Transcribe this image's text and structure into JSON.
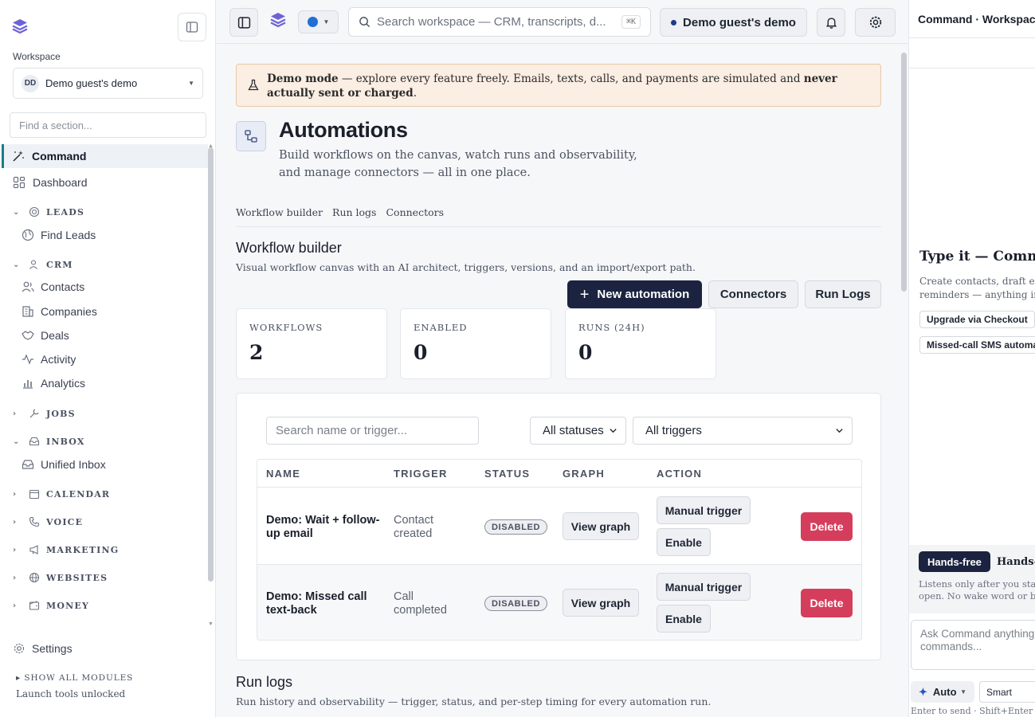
{
  "sidebar": {
    "workspace_label": "Workspace",
    "workspace": {
      "initials": "DD",
      "name": "Demo guest's demo"
    },
    "find_placeholder": "Find a section...",
    "active_item": "Command",
    "dashboard": "Dashboard",
    "groups": [
      {
        "label": "LEADS",
        "expanded": true,
        "items": [
          "Find Leads"
        ]
      },
      {
        "label": "CRM",
        "expanded": true,
        "items": [
          "Contacts",
          "Companies",
          "Deals",
          "Activity",
          "Analytics"
        ]
      },
      {
        "label": "JOBS",
        "expanded": false,
        "items": []
      },
      {
        "label": "INBOX",
        "expanded": true,
        "items": [
          "Unified Inbox"
        ]
      },
      {
        "label": "CALENDAR",
        "expanded": false,
        "items": []
      },
      {
        "label": "VOICE",
        "expanded": false,
        "items": []
      },
      {
        "label": "MARKETING",
        "expanded": false,
        "items": []
      },
      {
        "label": "WEBSITES",
        "expanded": false,
        "items": []
      },
      {
        "label": "MONEY",
        "expanded": false,
        "items": []
      }
    ],
    "settings": "Settings",
    "show_all": "SHOW ALL MODULES",
    "unlocked": "Launch tools unlocked"
  },
  "topbar": {
    "search_placeholder": "Search workspace — CRM, transcripts, d...",
    "shortcut": "⌘K",
    "demo_label": "Demo guest's demo",
    "status_color": "#1f6fd6"
  },
  "banner": {
    "bold1": "Demo mode",
    "text1": " — explore every feature freely. Emails, texts, calls, and payments are simulated and ",
    "bold2": "never actually sent or charged",
    "text2": "."
  },
  "page": {
    "title": "Automations",
    "description": "Build workflows on the canvas, watch runs and observability, and manage connectors — all in one place.",
    "tabs": [
      "Workflow builder",
      "Run logs",
      "Connectors"
    ]
  },
  "workflow_section": {
    "title": "Workflow builder",
    "description": "Visual workflow canvas with an AI architect, triggers, versions, and an import/export path.",
    "new_button": "New automation",
    "connectors_button": "Connectors",
    "runlogs_button": "Run Logs"
  },
  "stats": [
    {
      "label": "WORKFLOWS",
      "value": "2"
    },
    {
      "label": "ENABLED",
      "value": "0"
    },
    {
      "label": "RUNS (24H)",
      "value": "0"
    }
  ],
  "filters": {
    "search_placeholder": "Search name or trigger...",
    "status": "All statuses",
    "trigger": "All triggers"
  },
  "table": {
    "headers": [
      "NAME",
      "TRIGGER",
      "STATUS",
      "GRAPH",
      "ACTION"
    ],
    "rows": [
      {
        "name": "Demo: Wait + follow-up email",
        "trigger": "Contact created",
        "status": "DISABLED",
        "graph": "View graph",
        "manual": "Manual trigger",
        "enable": "Enable",
        "delete": "Delete"
      },
      {
        "name": "Demo: Missed call text-back",
        "trigger": "Call completed",
        "status": "DISABLED",
        "graph": "View graph",
        "manual": "Manual trigger",
        "enable": "Enable",
        "delete": "Delete"
      }
    ]
  },
  "run_logs": {
    "title": "Run logs",
    "description": "Run history and observability — trigger, status, and per-step timing for every automation run."
  },
  "right_panel": {
    "title": "Command · Workspace",
    "heading": "Type it — Command",
    "desc_line1": "Create contacts, draft ema",
    "desc_line2": "reminders — anything in",
    "chips": [
      "Upgrade via Checkout",
      "Missed-call SMS automat"
    ],
    "handsfree_button": "Hands-free",
    "handsfree_label": "Hands-fr",
    "handsfree_desc1": "Listens only after you start",
    "handsfree_desc2": "open. No wake word or back",
    "ask_placeholder": "Ask Command anything commands...",
    "auto": "Auto",
    "smart": "Smart",
    "enter_hint": "Enter to send · Shift+Enter for"
  }
}
